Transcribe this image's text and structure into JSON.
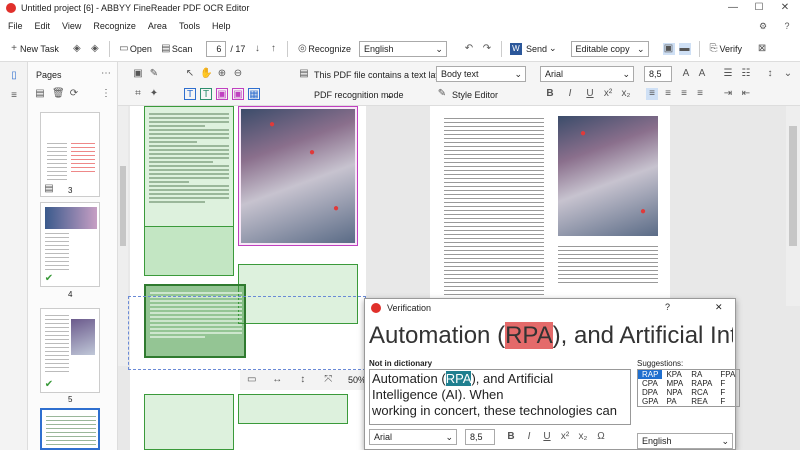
{
  "window": {
    "title": "Untitled project [6] - ABBYY FineReader PDF OCR Editor"
  },
  "menu": [
    "File",
    "Edit",
    "View",
    "Recognize",
    "Area",
    "Tools",
    "Help"
  ],
  "toolbar": {
    "new_task": "New Task",
    "open": "Open",
    "scan": "Scan",
    "page_current": "6",
    "page_total": "/ 17",
    "recognize": "Recognize",
    "language": "English",
    "send": "Send",
    "output_mode": "Editable copy",
    "verify": "Verify"
  },
  "pages_panel": {
    "title": "Pages",
    "page_numbers": [
      "3",
      "4",
      "5"
    ]
  },
  "ribbon": {
    "text_layer_notice": "This PDF file contains a text layer",
    "recognition_mode": "PDF recognition mode",
    "style": "Body text",
    "style_editor": "Style Editor",
    "font": "Arial",
    "font_size": "8,5"
  },
  "zoom": "50%",
  "verification": {
    "title": "Verification",
    "preview_text_before": "Automation (",
    "preview_highlight": "RPA",
    "preview_text_after": "), and Artificial Int",
    "not_in_dictionary_label": "Not in dictionary",
    "edit_line1_before": "Automation (",
    "edit_line1_highlight": "RPA",
    "edit_line1_after": "), and Artificial",
    "edit_line2": "Intelligence (AI). When",
    "edit_line3": "working in concert, these technologies can",
    "suggestions_label": "Suggestions:",
    "suggestions": [
      [
        "RAP",
        "KPA",
        "RA",
        "FPA"
      ],
      [
        "CPA",
        "MPA",
        "RAPA",
        "F"
      ],
      [
        "DPA",
        "NPA",
        "RCA",
        "F"
      ],
      [
        "GPA",
        "PA",
        "REA",
        "F"
      ]
    ],
    "font": "Arial",
    "font_size": "8,5",
    "language": "English",
    "help": "?",
    "close": "✕"
  }
}
